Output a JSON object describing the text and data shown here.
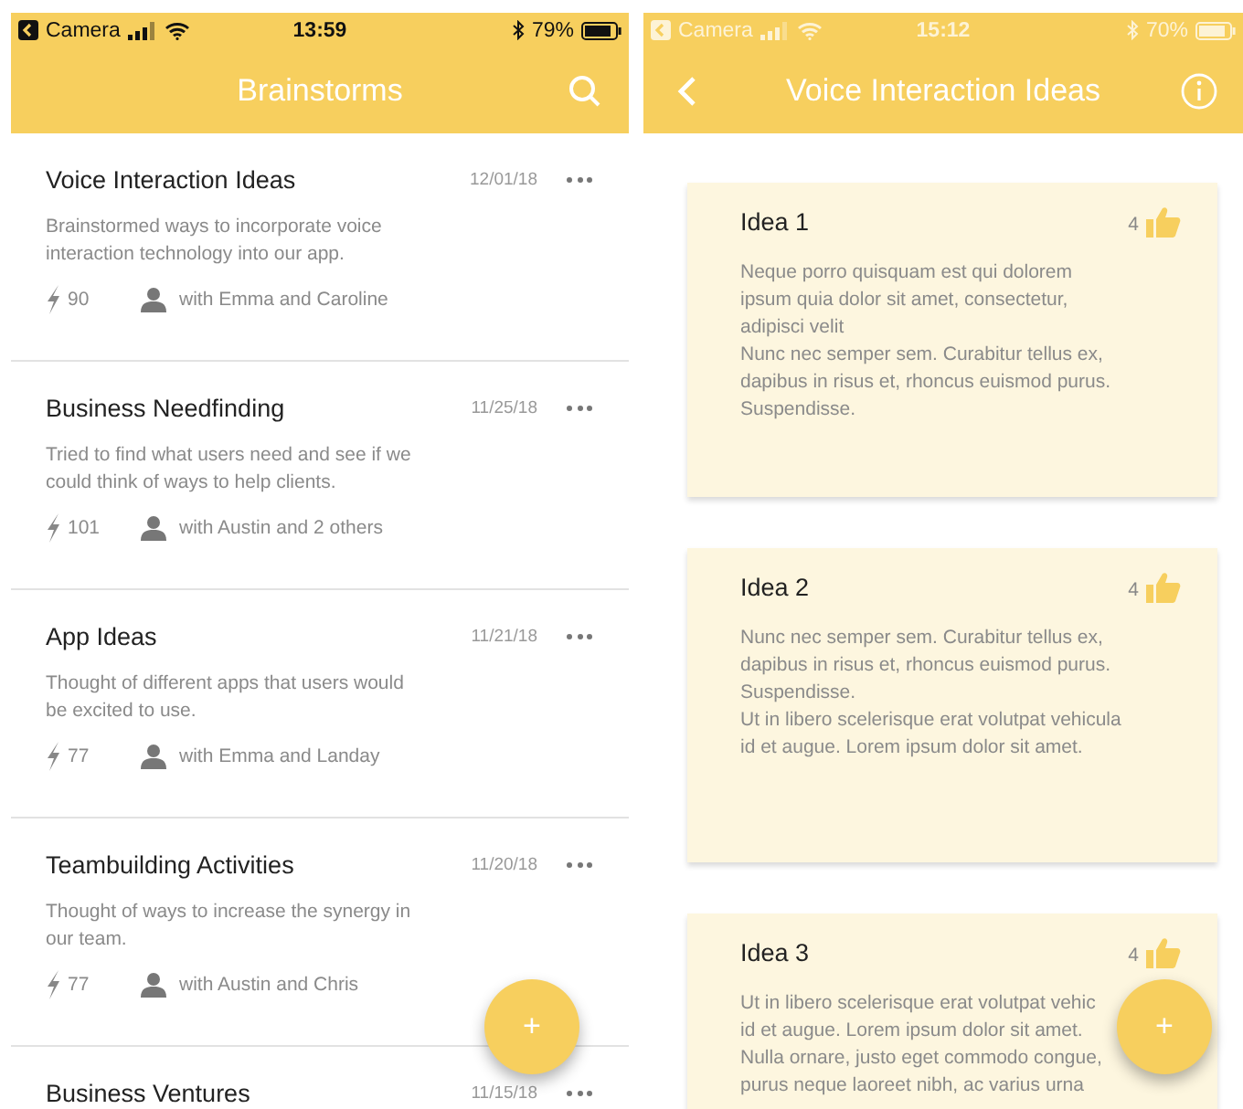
{
  "screens": [
    {
      "kind": "list",
      "status_bar": {
        "kind": "dark",
        "back_app": "Camera",
        "time": "13:59",
        "battery": "79%"
      },
      "header": {
        "title": "Brainstorms",
        "right_button": {
          "kind": "search"
        }
      },
      "items": [
        {
          "title": "Voice Interaction Ideas",
          "date": "12/01/18",
          "description": [
            "Brainstormed ways to incorporate voice",
            "interaction technology into our app."
          ],
          "ideas": "90",
          "people": "with Emma and Caroline"
        },
        {
          "title": "Business Needfinding",
          "date": "11/25/18",
          "description": [
            "Tried to find what users need and see if we",
            "could think of ways to help clients."
          ],
          "ideas": "101",
          "people": "with Austin and 2 others"
        },
        {
          "title": "App Ideas",
          "date": "11/21/18",
          "description": [
            "Thought of different apps that users would",
            "be excited to use."
          ],
          "ideas": "77",
          "people": "with Emma and Landay"
        },
        {
          "title": "Teambuilding Activities",
          "date": "11/20/18",
          "description": [
            "Thought of ways to increase the synergy in",
            "our team."
          ],
          "ideas": "77",
          "people": "with Austin and Chris"
        },
        {
          "title": "Business Ventures",
          "date": "11/15/18"
        }
      ],
      "fab": {
        "label": "+"
      }
    },
    {
      "kind": "detail",
      "status_bar": {
        "kind": "light",
        "back_app": "Camera",
        "time": "15:12",
        "battery": "70%"
      },
      "header": {
        "title": "Voice Interaction Ideas",
        "left_button": {
          "kind": "back"
        },
        "right_button": {
          "kind": "info"
        }
      },
      "ideas": [
        {
          "title": "Idea 1",
          "likes": "4",
          "body": [
            "Neque porro quisquam est qui dolorem",
            "ipsum quia dolor sit amet, consectetur,",
            "adipisci velit",
            "Nunc nec semper sem. Curabitur tellus ex,",
            "dapibus in risus et, rhoncus euismod purus.",
            "Suspendisse."
          ]
        },
        {
          "title": "Idea 2",
          "likes": "4",
          "body": [
            "Nunc nec semper sem. Curabitur tellus ex,",
            "dapibus in risus et, rhoncus euismod purus.",
            "Suspendisse.",
            "Ut in libero scelerisque erat volutpat vehicula",
            "id et augue. Lorem ipsum dolor sit amet."
          ]
        },
        {
          "title": "Idea 3",
          "likes": "4",
          "body": [
            "Ut in libero scelerisque erat volutpat vehic",
            "id et augue. Lorem ipsum dolor sit amet.",
            "Nulla ornare, justo eget commodo congue,",
            "purus neque laoreet nibh, ac varius urna"
          ]
        }
      ],
      "fab": {
        "label": "+"
      }
    }
  ]
}
